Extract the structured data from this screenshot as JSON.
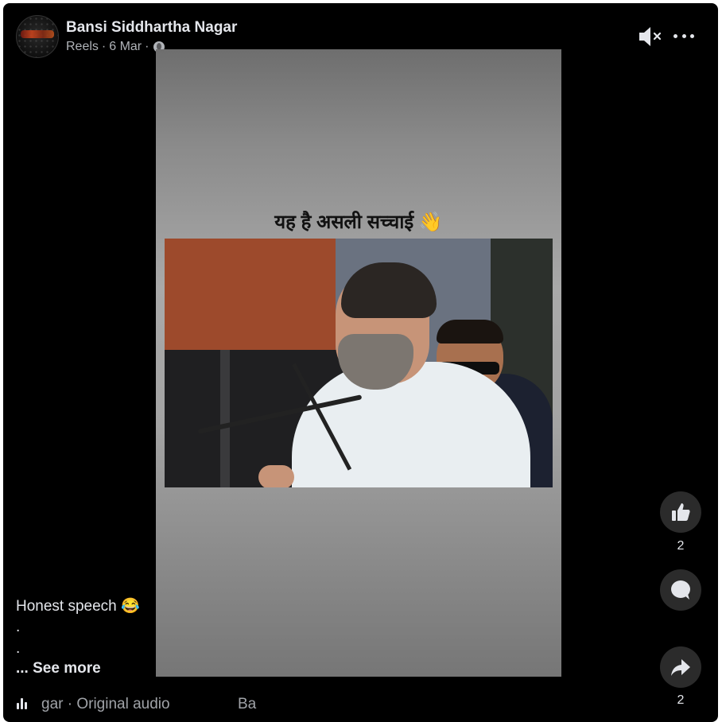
{
  "post": {
    "author": "Bansi Siddhartha Nagar",
    "meta_label": "Reels",
    "date": "6 Mar",
    "privacy_icon": "globe-icon"
  },
  "video": {
    "overlay_caption": "यह है असली सच्चाई 👋"
  },
  "description": {
    "text": "Honest speech 😂",
    "dot1": ".",
    "dot2": ".",
    "see_more": "... See more"
  },
  "audio": {
    "label": "gar · Original audio",
    "next": "Ba"
  },
  "actions": {
    "like_count": "2",
    "share_count": "2"
  },
  "colors": {
    "background": "#000000",
    "text_primary": "#e4e6eb",
    "text_secondary": "#b0b3b8",
    "button_bg": "#2b2b2b"
  }
}
